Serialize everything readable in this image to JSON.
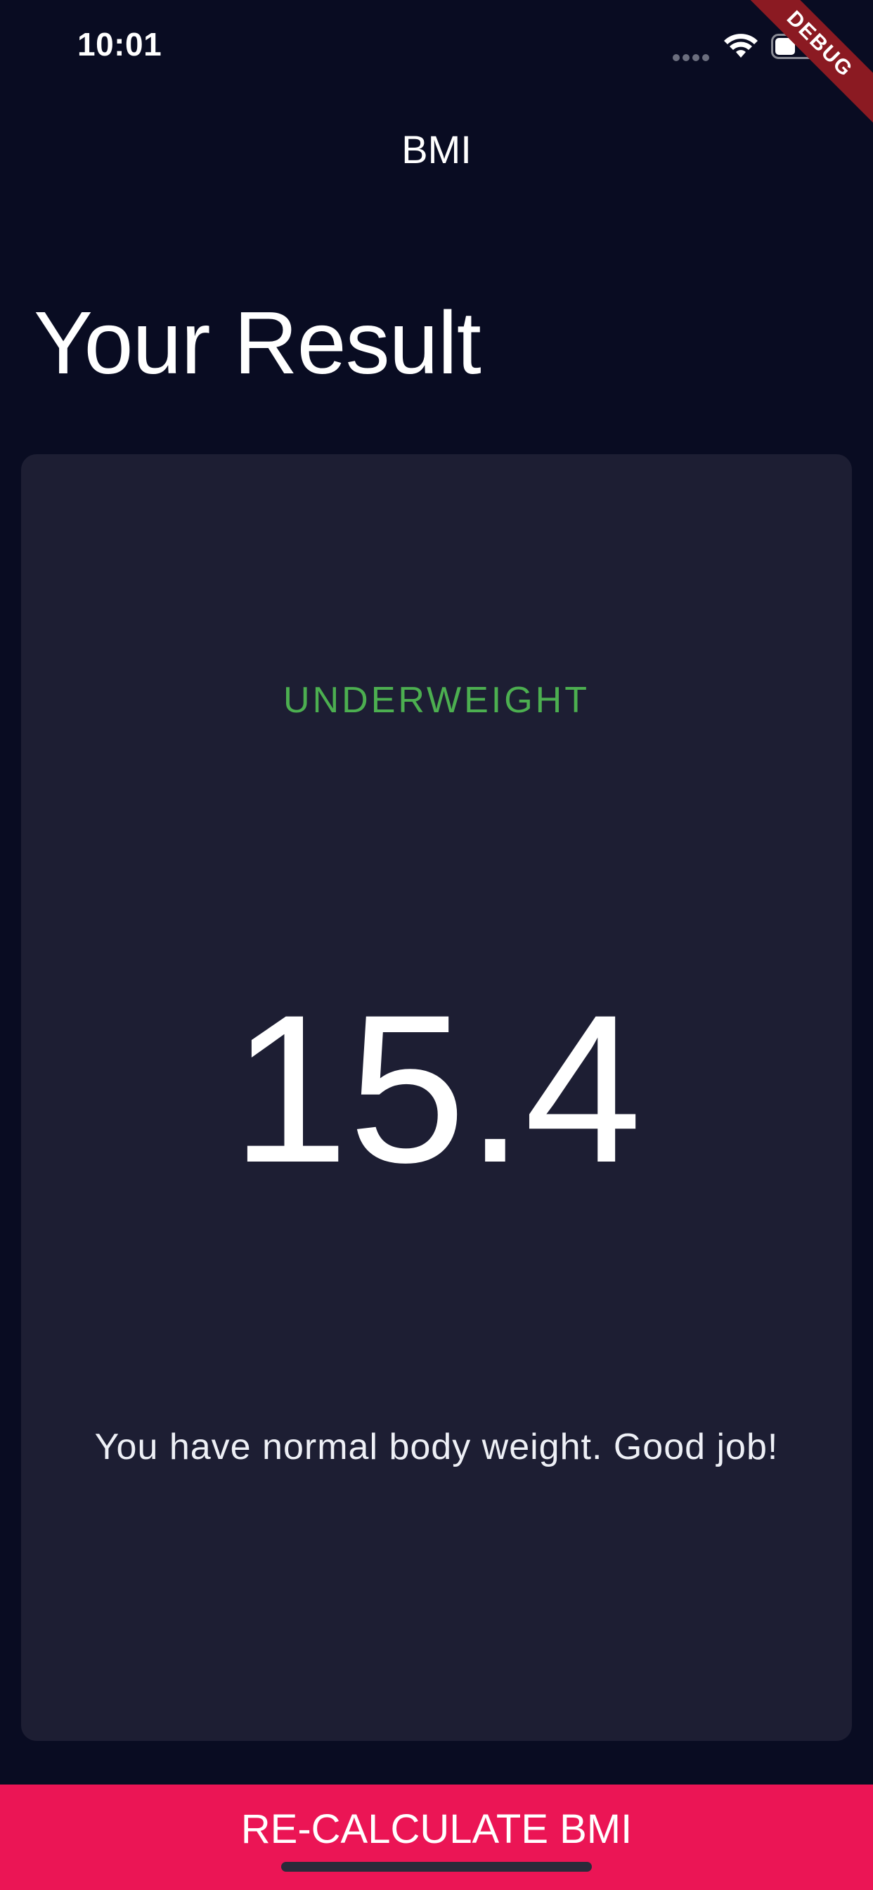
{
  "status_bar": {
    "time": "10:01"
  },
  "debug_banner": "DEBUG",
  "app_bar": {
    "title": "BMI"
  },
  "page": {
    "title": "Your Result"
  },
  "result_card": {
    "category": "UNDERWEIGHT",
    "bmi_value": "15.4",
    "message": "You have normal body weight. Good job!"
  },
  "recalculate_button": {
    "label": "RE-CALCULATE BMI"
  },
  "colors": {
    "background": "#090c22",
    "card": "#1d1e33",
    "category_green": "#4caf50",
    "button_pink": "#eb1555",
    "debug_red": "#8b1a22"
  },
  "icons": [
    "signal-icon",
    "wifi-icon",
    "battery-icon"
  ]
}
